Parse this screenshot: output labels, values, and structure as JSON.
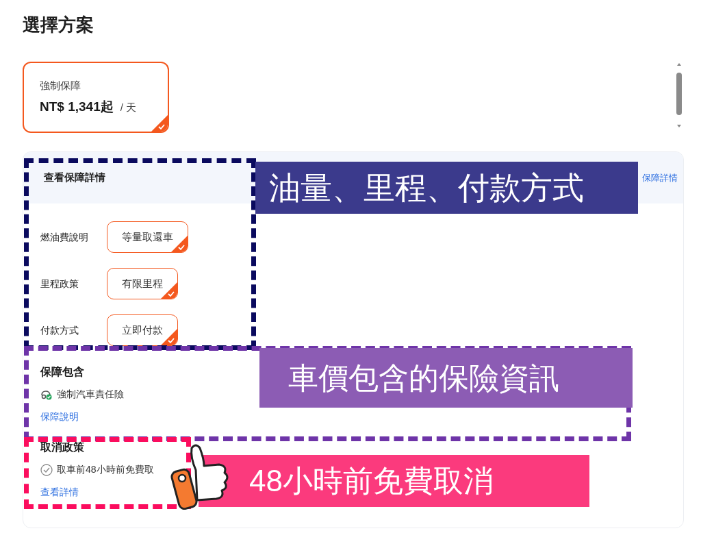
{
  "heading": "選擇方案",
  "plans": [
    {
      "name": "強制保障",
      "price": "NT$ 1,341起",
      "unit": "/ 天",
      "selected": true
    }
  ],
  "details": {
    "header": "查看保障詳情",
    "header_link": "保障詳情",
    "options": [
      {
        "label": "燃油費說明",
        "value": "等量取還車",
        "selected": true
      },
      {
        "label": "里程政策",
        "value": "有限里程",
        "selected": true
      },
      {
        "label": "付款方式",
        "value": "立即付款",
        "selected": true
      }
    ]
  },
  "coverage": {
    "title": "保障包含",
    "items": [
      "強制汽車責任險"
    ],
    "link": "保障說明"
  },
  "cancellation": {
    "title": "取消政策",
    "items": [
      "取車前48小時前免費取"
    ],
    "link": "查看詳情"
  },
  "annotations": [
    {
      "text": "油量、里程、付款方式",
      "color": "#3b3a8c"
    },
    {
      "text": "車價包含的保險資訊",
      "color": "#8c5cb4"
    },
    {
      "text": "48小時前免費取消",
      "color": "#fb3a7d"
    }
  ]
}
